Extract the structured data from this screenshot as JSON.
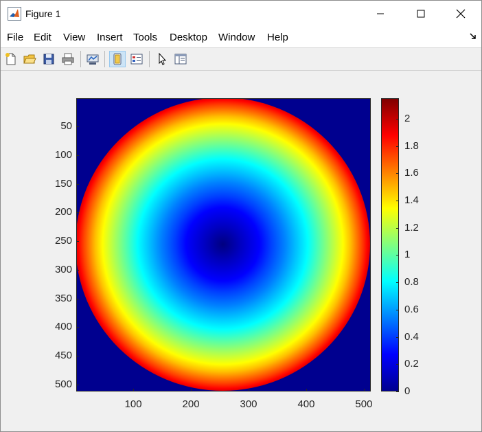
{
  "window": {
    "title": "Figure 1",
    "controls": [
      "minimize",
      "maximize",
      "close"
    ]
  },
  "menu": [
    "File",
    "Edit",
    "View",
    "Insert",
    "Tools",
    "Desktop",
    "Window",
    "Help"
  ],
  "toolbar": {
    "buttons": [
      {
        "name": "new-figure-icon",
        "active": false
      },
      {
        "name": "open-file-icon",
        "active": false
      },
      {
        "name": "save-icon",
        "active": false
      },
      {
        "name": "print-icon",
        "active": false
      },
      {
        "name": "link-plot-icon",
        "active": false
      },
      {
        "name": "hide-plot-tools-icon",
        "active": true
      },
      {
        "name": "insert-legend-icon",
        "active": false
      },
      {
        "name": "edit-plot-pointer-icon",
        "active": false
      },
      {
        "name": "show-plot-tools-icon",
        "active": false
      }
    ]
  },
  "chart_data": {
    "type": "heatmap",
    "title": "",
    "xlabel": "",
    "ylabel": "",
    "x_ticks": [
      "100",
      "200",
      "300",
      "400",
      "500"
    ],
    "y_ticks": [
      "50",
      "100",
      "150",
      "200",
      "250",
      "300",
      "350",
      "400",
      "450",
      "500"
    ],
    "xlim": [
      1,
      512
    ],
    "ylim": [
      1,
      512
    ],
    "y_direction": "reverse",
    "colormap": "jet",
    "colorbar": {
      "ticks": [
        "0",
        "0.2",
        "0.4",
        "0.6",
        "0.8",
        "1",
        "1.2",
        "1.4",
        "1.6",
        "1.8",
        "2"
      ],
      "range": [
        0,
        2.15
      ]
    },
    "description_values": {
      "center_value": 0,
      "edge_value": 2.15,
      "outside_value": 0,
      "center": [
        256,
        256
      ],
      "radius": 256
    }
  }
}
